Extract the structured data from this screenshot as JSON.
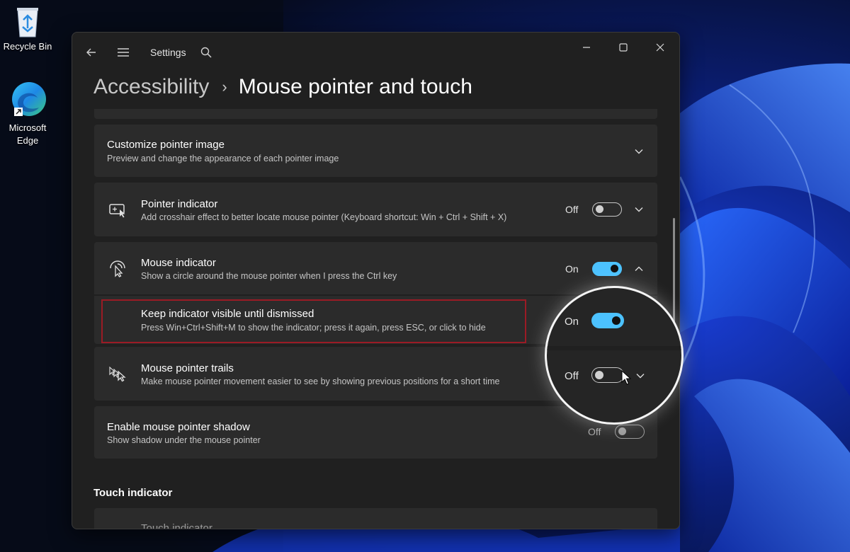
{
  "desktop": {
    "recycle_bin_label": "Recycle Bin",
    "edge_label": "Microsoft Edge",
    "edge_label_line1": "Microsoft",
    "edge_label_line2": "Edge"
  },
  "window": {
    "app_title": "Settings",
    "icons": {
      "back": "back-arrow-icon",
      "menu": "hamburger-menu-icon",
      "search": "search-icon",
      "minimize": "minimize-icon",
      "maximize": "maximize-icon",
      "close": "close-icon"
    }
  },
  "breadcrumb": {
    "parent": "Accessibility",
    "separator": "›",
    "current": "Mouse pointer and touch"
  },
  "settings": [
    {
      "id": "customize-pointer-image",
      "title": "Customize pointer image",
      "description": "Preview and change the appearance of each pointer image",
      "expander": "chevron-down-icon"
    },
    {
      "id": "pointer-indicator",
      "title": "Pointer indicator",
      "description": "Add crosshair effect to better locate mouse pointer (Keyboard shortcut: Win + Ctrl + Shift + X)",
      "state_label": "Off",
      "toggle": false,
      "icon": "crosshair-pointer-icon",
      "expander": "chevron-down-icon"
    },
    {
      "id": "mouse-indicator",
      "title": "Mouse indicator",
      "description": "Show a circle around the mouse pointer when I press the Ctrl key",
      "state_label": "On",
      "toggle": true,
      "icon": "pointer-ripple-icon",
      "expander": "chevron-up-icon"
    },
    {
      "id": "keep-indicator-visible",
      "title": "Keep indicator visible until dismissed",
      "description": "Press Win+Ctrl+Shift+M to show the indicator; press it again, press ESC, or click to hide",
      "state_label": "On",
      "toggle": true
    },
    {
      "id": "mouse-pointer-trails",
      "title": "Mouse pointer trails",
      "description": "Make mouse pointer movement easier to see by showing previous positions for a short time",
      "state_label": "Off",
      "toggle": false,
      "icon": "pointer-trails-icon",
      "expander": "chevron-down-icon"
    },
    {
      "id": "mouse-pointer-shadow",
      "title": "Enable mouse pointer shadow",
      "description": "Show shadow under the mouse pointer",
      "state_label": "Off",
      "toggle": false
    }
  ],
  "touch_section": {
    "heading": "Touch indicator",
    "row_title": "Touch indicator"
  },
  "colors": {
    "accent": "#4cc2ff",
    "window_bg": "#202020",
    "card_bg": "#2b2b2b",
    "highlight_border": "#9b1b25"
  }
}
